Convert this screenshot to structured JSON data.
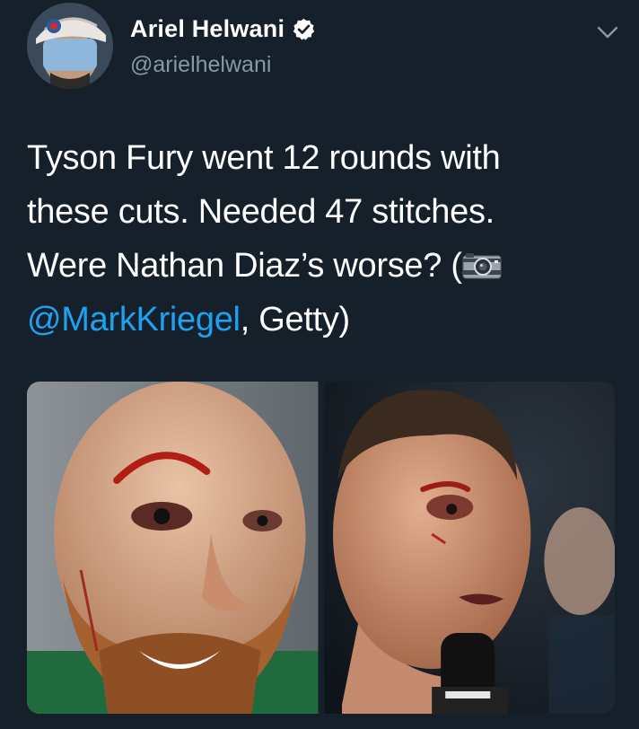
{
  "tweet": {
    "author": {
      "display_name": "Ariel Helwani",
      "handle": "@arielhelwani",
      "verified": true
    },
    "text": {
      "line1": "Tyson Fury went 12 rounds with",
      "line2": "these cuts. Needed 47 stitches.",
      "line3_before_emoji": "Were Nathan Diaz’s worse? (",
      "emoji": "camera-emoji",
      "mention": "@MarkKriegel",
      "after_mention": ", Getty)"
    },
    "media": {
      "photo_count": 2,
      "photos": [
        "tyson-fury-cut-photo",
        "nathan-diaz-cut-photo"
      ]
    }
  },
  "colors": {
    "background": "#15202b",
    "text": "#ffffff",
    "secondary_text": "#8899a6",
    "link": "#1da1f2"
  }
}
